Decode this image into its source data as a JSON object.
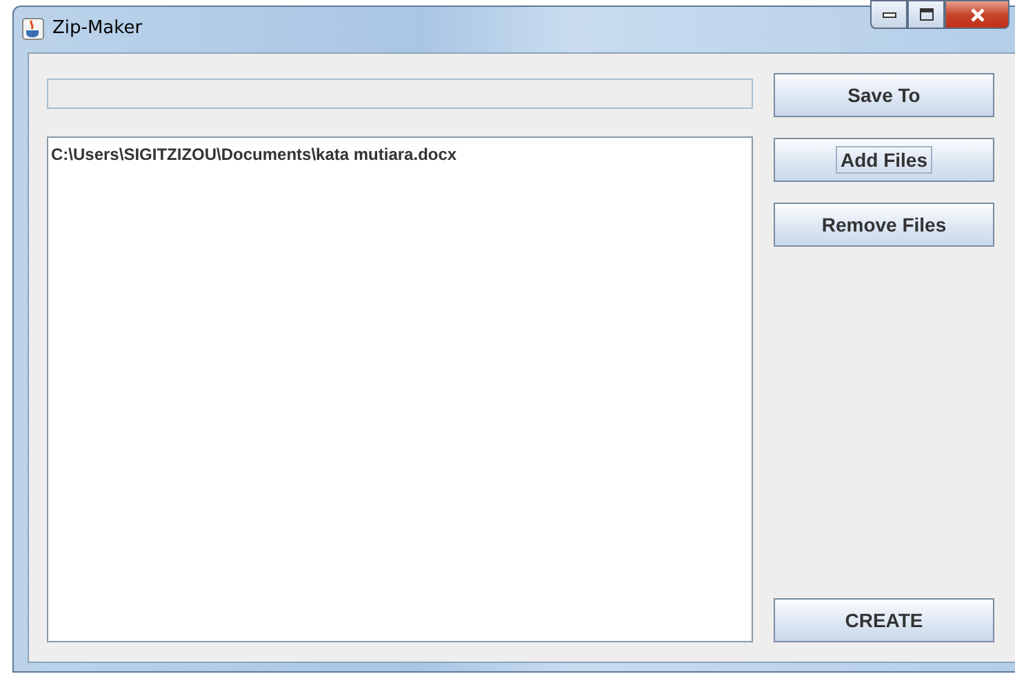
{
  "window": {
    "title": "Zip-Maker"
  },
  "file_list": {
    "items": [
      "C:\\Users\\SIGITZIZOU\\Documents\\kata mutiara.docx"
    ]
  },
  "buttons": [
    {
      "label": "Save To",
      "focused": false
    },
    {
      "label": "Add Files",
      "focused": true
    },
    {
      "label": "Remove Files",
      "focused": false
    }
  ],
  "create_button": {
    "label": "CREATE",
    "focused": false
  }
}
